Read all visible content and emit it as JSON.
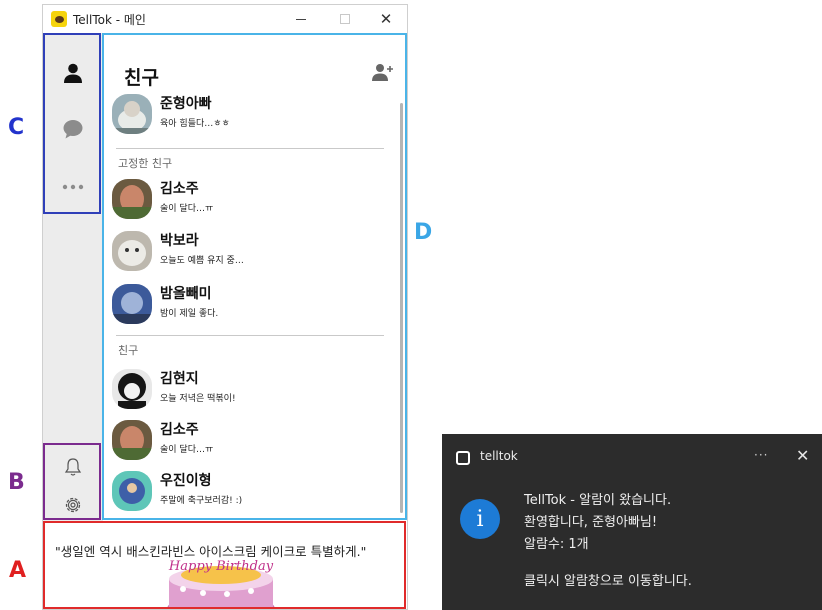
{
  "window": {
    "title": "TellTok - 메인",
    "controls": {
      "minimize": "minimize",
      "maximize": "maximize",
      "close": "✕"
    }
  },
  "markers": {
    "a": "A",
    "b": "B",
    "c": "C",
    "d": "D"
  },
  "header": {
    "title": "친구"
  },
  "me": {
    "name": "준형아빠",
    "status": "육아 힘들다…ㅎㅎ"
  },
  "sections": {
    "pinned": "고정한 친구",
    "friends": "친구"
  },
  "pinned": [
    {
      "name": "김소주",
      "status": "술이 달다…ㅠ"
    },
    {
      "name": "박보라",
      "status": "오늘도 예쁨 유지 중…"
    },
    {
      "name": "밤올빼미",
      "status": "밤이 제일 좋다."
    }
  ],
  "friends": [
    {
      "name": "김현지",
      "status": "오늘 저녁은 떡볶이!"
    },
    {
      "name": "김소주",
      "status": "술이 달다…ㅠ"
    },
    {
      "name": "우진이형",
      "status": "주말에 축구보러감! :)"
    }
  ],
  "banner": {
    "text": "\"생일엔 역시 배스킨라빈스 아이스크림 케이크로 특별하게.\"",
    "cake_text": "Happy Birthday"
  },
  "toast": {
    "app": "telltok",
    "more": "···",
    "close": "✕",
    "title": "TellTok - 알람이 왔습니다.",
    "line1": "환영합니다, 준형아빠님!",
    "line2": "알람수: 1개",
    "line3": "클릭시 알람창으로 이동합니다."
  },
  "colors": {
    "marker_a": "#e02020",
    "marker_b": "#7b2b8e",
    "marker_c": "#2233cc",
    "marker_d": "#3aa6e6",
    "toast_bg": "#2c2c2c",
    "info_blue": "#1d7bd6"
  }
}
